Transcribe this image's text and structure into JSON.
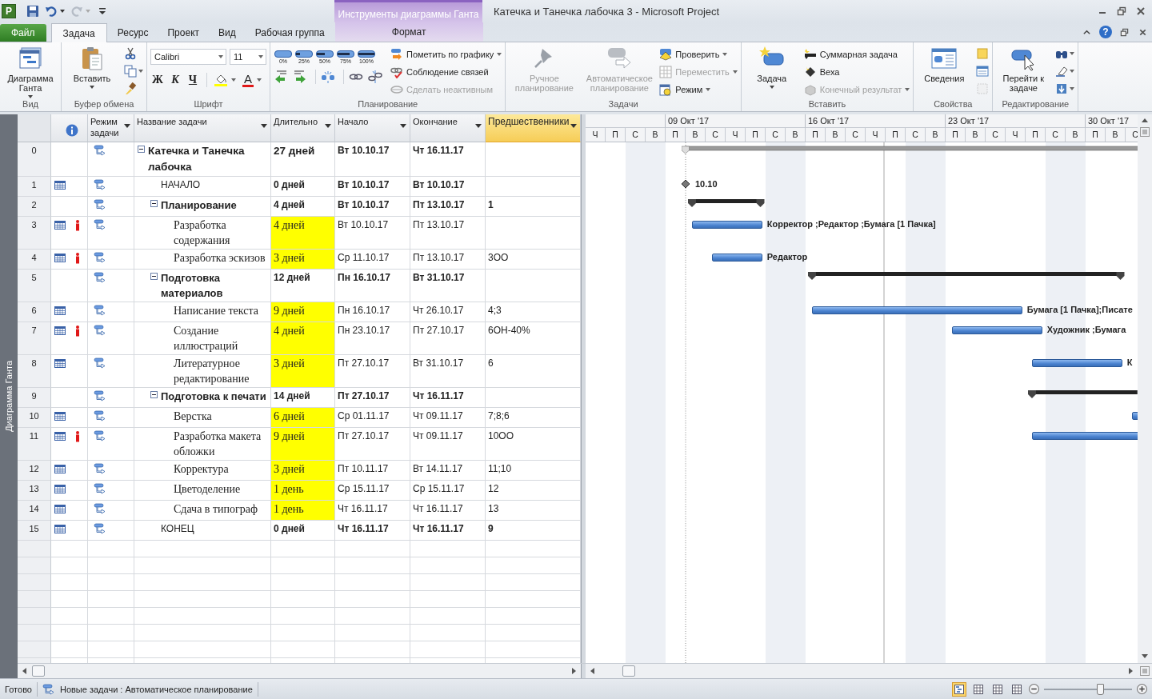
{
  "app_icon": {
    "letter": "P"
  },
  "contextual": {
    "title": "Инструменты диаграммы Ганта"
  },
  "window": {
    "title": "Катечка и Танечка лабочка 3  -  Microsoft Project",
    "help": "?"
  },
  "tabs": [
    {
      "label": "Файл",
      "kind": "file",
      "selected": false
    },
    {
      "label": "Задача",
      "kind": "tab",
      "selected": true
    },
    {
      "label": "Ресурс",
      "kind": "tab",
      "selected": false
    },
    {
      "label": "Проект",
      "kind": "tab",
      "selected": false
    },
    {
      "label": "Вид",
      "kind": "tab",
      "selected": false
    },
    {
      "label": "Рабочая группа",
      "kind": "tab",
      "selected": false
    },
    {
      "label": "Формат",
      "kind": "contextual",
      "selected": false
    }
  ],
  "ribbon": [
    {
      "label": "Вид",
      "columns": [
        {
          "kind": "large",
          "label": "Диаграмма Ганта",
          "disabled": false,
          "dropdown": true
        }
      ]
    },
    {
      "label": "Буфер обмена",
      "columns": [
        {
          "kind": "large",
          "label": "Вставить",
          "disabled": false,
          "dropdown": true
        },
        {
          "kind": "icons",
          "buttons": [
            {
              "dropdown": false,
              "disabled": false
            },
            {
              "dropdown": true,
              "disabled": false
            },
            {
              "dropdown": false,
              "disabled": false
            }
          ]
        }
      ]
    },
    {
      "label": "Шрифт",
      "columns": [
        {
          "kind": "font",
          "font": "Calibri",
          "size": "11",
          "styles": [
            "Ж",
            "К",
            "Ч"
          ],
          "color_letter": "А"
        }
      ]
    },
    {
      "label": "Планирование",
      "columns": [
        {
          "kind": "progress",
          "marks": [
            "0%",
            "25%",
            "50%",
            "75%",
            "100%"
          ]
        },
        {
          "kind": "stack",
          "rows": [
            {
              "label": "Пометить по графику",
              "disabled": false,
              "dropdown": true
            },
            {
              "label": "Соблюдение связей",
              "disabled": false,
              "dropdown": false
            },
            {
              "label": "Сделать неактивным",
              "disabled": true,
              "dropdown": false
            }
          ]
        }
      ]
    },
    {
      "label": "Задачи",
      "columns": [
        {
          "kind": "large",
          "label": "Ручное планирование",
          "disabled": true,
          "dropdown": false
        },
        {
          "kind": "large",
          "label": "Автоматическое планирование",
          "disabled": true,
          "dropdown": false
        },
        {
          "kind": "stack",
          "rows": [
            {
              "label": "Проверить",
              "disabled": false,
              "dropdown": true
            },
            {
              "label": "Переместить",
              "disabled": true,
              "dropdown": true
            },
            {
              "label": "Режим",
              "disabled": false,
              "dropdown": true
            }
          ]
        }
      ]
    },
    {
      "label": "Вставить",
      "columns": [
        {
          "kind": "large",
          "label": "Задача",
          "disabled": false,
          "dropdown": true
        },
        {
          "kind": "stack",
          "rows": [
            {
              "label": "Суммарная задача",
              "disabled": false,
              "dropdown": false
            },
            {
              "label": "Веха",
              "disabled": false,
              "dropdown": false
            },
            {
              "label": "Конечный результат",
              "disabled": true,
              "dropdown": true
            }
          ]
        }
      ]
    },
    {
      "label": "Свойства",
      "columns": [
        {
          "kind": "large",
          "label": "Сведения",
          "disabled": false,
          "dropdown": false
        },
        {
          "kind": "icons",
          "buttons": [
            {
              "dropdown": false,
              "disabled": false
            },
            {
              "dropdown": false,
              "disabled": false
            },
            {
              "dropdown": false,
              "disabled": true
            }
          ]
        }
      ]
    },
    {
      "label": "Редактирование",
      "columns": [
        {
          "kind": "large",
          "label": "Перейти к задаче",
          "disabled": false,
          "dropdown": false
        },
        {
          "kind": "icons",
          "buttons": [
            {
              "dropdown": true,
              "disabled": false
            },
            {
              "dropdown": true,
              "disabled": false
            },
            {
              "dropdown": true,
              "disabled": false
            }
          ]
        }
      ]
    }
  ],
  "view_bar": {
    "label": "Диаграмма Ганта"
  },
  "table": {
    "columns": [
      {
        "kind": "info",
        "selected": false
      },
      {
        "kind": "mode",
        "label": "Режим задачи",
        "selected": false
      },
      {
        "kind": "name",
        "label": "Название задачи",
        "selected": false
      },
      {
        "kind": "duration",
        "label": "Длительно",
        "selected": false
      },
      {
        "kind": "start",
        "label": "Начало",
        "selected": false
      },
      {
        "kind": "finish",
        "label": "Окончание",
        "selected": false
      },
      {
        "kind": "predecessors",
        "label": "Предшественники",
        "selected": true
      }
    ],
    "rows": [
      {
        "id": "0",
        "kind": "project",
        "expanded": true,
        "calendar": false,
        "overallocated": false,
        "name": "Катечка и Танечка лабочка",
        "duration": "27 дней",
        "start": "Вт 10.10.17",
        "finish": "Чт 16.11.17",
        "children": [
          {
            "id": "1",
            "kind": "milestone",
            "calendar": true,
            "overallocated": false,
            "name": "НАЧАЛО",
            "duration": "0 дней",
            "start": "Вт 10.10.17",
            "finish": "Вт 10.10.17",
            "bar_label": "10.10"
          },
          {
            "id": "2",
            "kind": "summary",
            "expanded": true,
            "calendar": false,
            "overallocated": false,
            "name": "Планирование",
            "duration": "4 дней",
            "start": "Вт 10.10.17",
            "finish": "Пт 13.10.17",
            "predecessors": "1",
            "children": [
              {
                "id": "3",
                "kind": "task",
                "calendar": true,
                "overallocated": true,
                "name": "Разработка содержания",
                "duration": "4 дней",
                "start": "Вт 10.10.17",
                "finish": "Пт 13.10.17",
                "bar_label": "Корректор ;Редактор ;Бумага [1 Пачка]"
              },
              {
                "id": "4",
                "kind": "task",
                "calendar": true,
                "overallocated": true,
                "name": "Разработка эскизов",
                "duration": "3 дней",
                "start": "Ср 11.10.17",
                "finish": "Пт 13.10.17",
                "predecessors": "3ОО",
                "bar_label": "Редактор"
              }
            ]
          },
          {
            "id": "5",
            "kind": "summary",
            "expanded": true,
            "calendar": false,
            "overallocated": false,
            "name": "Подготовка материалов",
            "duration": "12 дней",
            "start": "Пн 16.10.17",
            "finish": "Вт 31.10.17",
            "children": [
              {
                "id": "6",
                "kind": "task",
                "calendar": true,
                "overallocated": false,
                "name": "Написание текста",
                "duration": "9 дней",
                "start": "Пн 16.10.17",
                "finish": "Чт 26.10.17",
                "predecessors": "4;3",
                "bar_label": "Бумага [1 Пачка];Писате"
              },
              {
                "id": "7",
                "kind": "task",
                "calendar": true,
                "overallocated": true,
                "name": "Создание иллюстраций",
                "duration": "4 дней",
                "start": "Пн 23.10.17",
                "finish": "Пт 27.10.17",
                "predecessors": "6ОН-40%",
                "bar_label": "Художник ;Бумага"
              },
              {
                "id": "8",
                "kind": "task",
                "calendar": true,
                "overallocated": false,
                "name": "Литературное редактирование",
                "duration": "3 дней",
                "start": "Пт 27.10.17",
                "finish": "Вт 31.10.17",
                "predecessors": "6",
                "bar_label": "К"
              }
            ]
          },
          {
            "id": "9",
            "kind": "summary",
            "expanded": true,
            "calendar": false,
            "overallocated": false,
            "name": "Подготовка к печати",
            "duration": "14 дней",
            "start": "Пт 27.10.17",
            "finish": "Чт 16.11.17",
            "children": [
              {
                "id": "10",
                "kind": "task",
                "calendar": true,
                "overallocated": false,
                "name": "Верстка",
                "duration": "6 дней",
                "start": "Ср 01.11.17",
                "finish": "Чт 09.11.17",
                "predecessors": "7;8;6"
              },
              {
                "id": "11",
                "kind": "task",
                "calendar": true,
                "overallocated": true,
                "name": "Разработка макета обложки",
                "duration": "9 дней",
                "start": "Пт 27.10.17",
                "finish": "Чт 09.11.17",
                "predecessors": "10ОО"
              },
              {
                "id": "12",
                "kind": "task",
                "calendar": true,
                "overallocated": false,
                "name": "Корректура",
                "duration": "3 дней",
                "start": "Пт 10.11.17",
                "finish": "Вт 14.11.17",
                "predecessors": "11;10"
              },
              {
                "id": "13",
                "kind": "task",
                "calendar": true,
                "overallocated": false,
                "name": "Цветоделение",
                "duration": "1 день",
                "start": "Ср 15.11.17",
                "finish": "Ср 15.11.17",
                "predecessors": "12"
              },
              {
                "id": "14",
                "kind": "task",
                "calendar": true,
                "overallocated": false,
                "name": "Сдача в типограф",
                "duration": "1 день",
                "start": "Чт 16.11.17",
                "finish": "Чт 16.11.17",
                "predecessors": "13"
              }
            ]
          },
          {
            "id": "15",
            "kind": "milestone",
            "calendar": true,
            "overallocated": false,
            "name": "КОНЕЦ",
            "duration": "0 дней",
            "start": "Чт 16.11.17",
            "finish": "Чт 16.11.17",
            "predecessors": "9"
          }
        ]
      }
    ]
  },
  "gantt": {
    "lead_days": [
      {
        "letter": "Ч",
        "weekend": false
      },
      {
        "letter": "П",
        "weekend": false
      },
      {
        "letter": "С",
        "weekend": true
      },
      {
        "letter": "В",
        "weekend": true
      }
    ],
    "weeks": [
      {
        "label": "09 Окт '17",
        "days": [
          {
            "letter": "П",
            "weekend": false
          },
          {
            "letter": "В",
            "weekend": false
          },
          {
            "letter": "С",
            "weekend": false
          },
          {
            "letter": "Ч",
            "weekend": false
          },
          {
            "letter": "П",
            "weekend": false
          },
          {
            "letter": "С",
            "weekend": true
          },
          {
            "letter": "В",
            "weekend": true
          }
        ]
      },
      {
        "label": "16 Окт '17",
        "days": [
          {
            "letter": "П",
            "weekend": false
          },
          {
            "letter": "В",
            "weekend": false
          },
          {
            "letter": "С",
            "weekend": false
          },
          {
            "letter": "Ч",
            "weekend": false
          },
          {
            "letter": "П",
            "weekend": false
          },
          {
            "letter": "С",
            "weekend": true
          },
          {
            "letter": "В",
            "weekend": true
          }
        ]
      },
      {
        "label": "23 Окт '17",
        "days": [
          {
            "letter": "П",
            "weekend": false
          },
          {
            "letter": "В",
            "weekend": false
          },
          {
            "letter": "С",
            "weekend": false
          },
          {
            "letter": "Ч",
            "weekend": false
          },
          {
            "letter": "П",
            "weekend": false
          },
          {
            "letter": "С",
            "weekend": true
          },
          {
            "letter": "В",
            "weekend": true
          }
        ]
      },
      {
        "label": "30 Окт '17",
        "days": [
          {
            "letter": "П",
            "weekend": false
          },
          {
            "letter": "В",
            "weekend": false
          },
          {
            "letter": "С",
            "weekend": false
          }
        ]
      }
    ]
  },
  "status_bar": {
    "ready": "Готово",
    "mode": "Новые задачи : Автоматическое планирование",
    "views": [
      {
        "selected": true
      },
      {
        "selected": false
      },
      {
        "selected": false
      },
      {
        "selected": false
      }
    ],
    "zoom": {
      "level": 0.63
    }
  }
}
